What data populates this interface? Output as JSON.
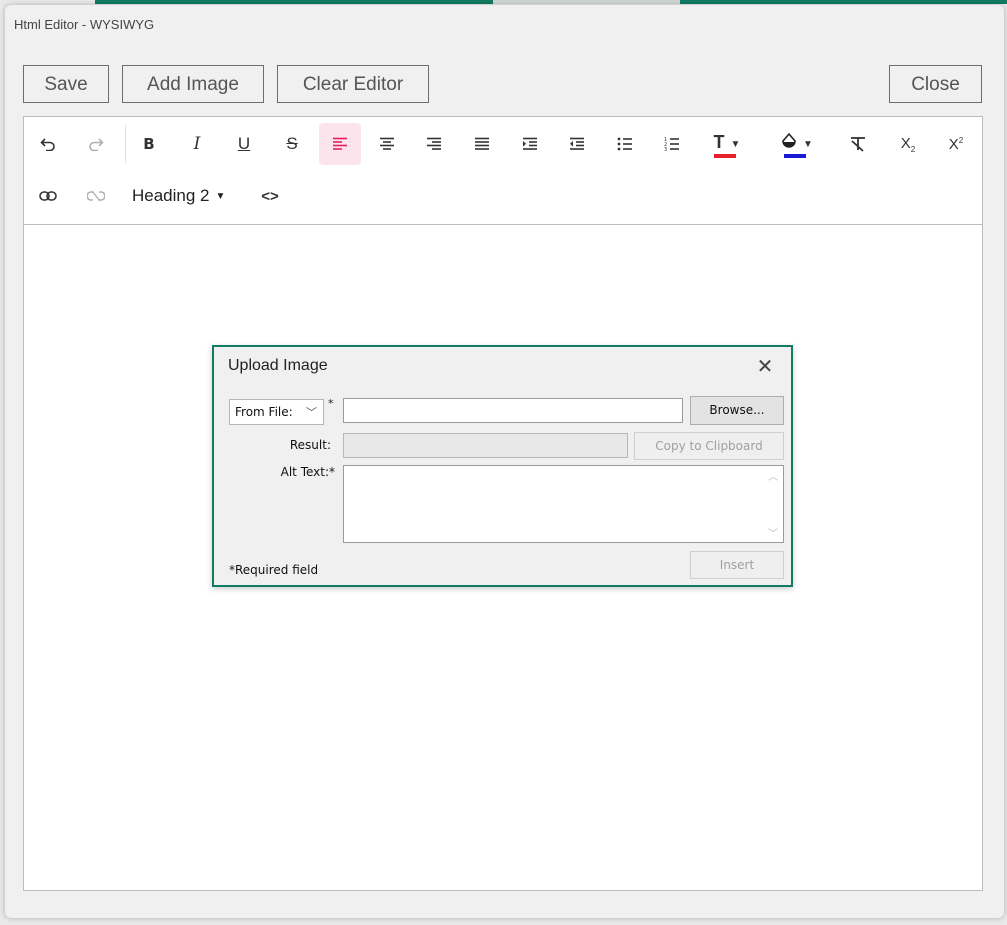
{
  "window": {
    "title": "Html Editor - WYSIWYG"
  },
  "actions": {
    "save": "Save",
    "add_image": "Add Image",
    "clear_editor": "Clear Editor",
    "close": "Close"
  },
  "toolbar": {
    "bold": "B",
    "italic": "I",
    "underline": "U",
    "strike": "S",
    "subscript": "X",
    "subscript_small": "2",
    "superscript": "X",
    "superscript_small": "2",
    "font_color_glyph": "T",
    "font_color": "#e8202a",
    "background_color": "#1a1ad6",
    "heading": "Heading 2",
    "source": "<>"
  },
  "dialog": {
    "title": "Upload Image",
    "source_select": "From File:",
    "required_mark": "*",
    "browse": "Browse...",
    "result_label": "Result:",
    "copy": "Copy to Clipboard",
    "alt_label": "Alt Text:*",
    "insert": "Insert",
    "required_note": "*Required field"
  },
  "colors": {
    "accent": "#127b63",
    "active_align_bg": "#fce4ec",
    "active_align_fg": "#e91e63"
  }
}
